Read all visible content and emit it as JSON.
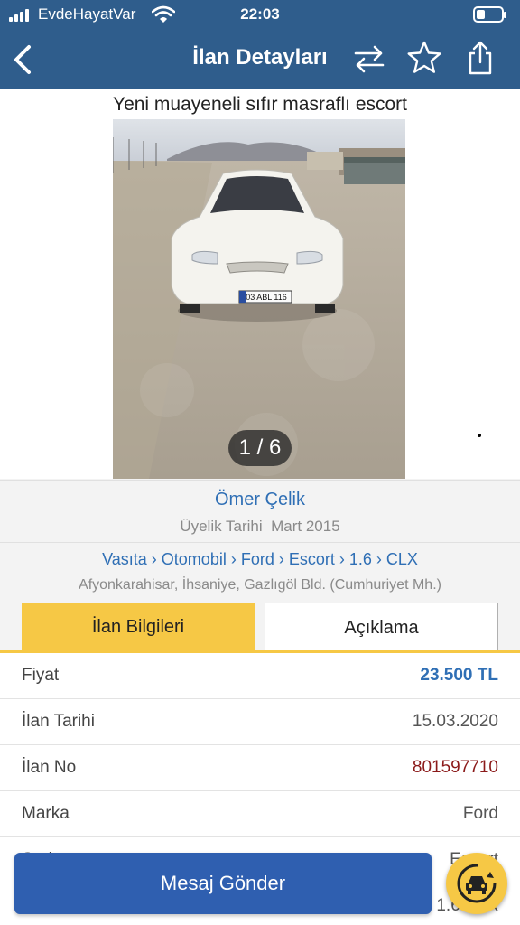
{
  "status": {
    "carrier": "EvdeHayatVar",
    "time": "22:03"
  },
  "header": {
    "title": "İlan Detayları",
    "back_icon": "chevron-left-icon",
    "swap_icon": "swap-arrows-icon",
    "favorite_icon": "star-icon",
    "share_icon": "share-icon"
  },
  "listing": {
    "title": "Yeni muayeneli sıfır masraflı escort",
    "photo_counter": "1 / 6",
    "plate": "03 ABL 116"
  },
  "seller": {
    "name": "Ömer Çelik",
    "member_since_label": "Üyelik Tarihi",
    "member_since_value": "Mart 2015"
  },
  "category": {
    "breadcrumb": "Vasıta › Otomobil › Ford › Escort › 1.6 › CLX",
    "location": "Afyonkarahisar, İhsaniye, Gazlıgöl Bld. (Cumhuriyet Mh.)"
  },
  "tabs": {
    "info": "İlan Bilgileri",
    "description": "Açıklama"
  },
  "details": [
    {
      "key": "Fiyat",
      "value": "23.500 TL"
    },
    {
      "key": "İlan Tarihi",
      "value": "15.03.2020"
    },
    {
      "key": "İlan No",
      "value": "801597710"
    },
    {
      "key": "Marka",
      "value": "Ford"
    },
    {
      "key": "Seri",
      "value": "Escort"
    },
    {
      "key": "Model",
      "value": "1.6 CLX"
    }
  ],
  "cta": {
    "label": "Mesaj Gönder",
    "fab_icon": "car-icon"
  },
  "colors": {
    "header": "#2f5d8c",
    "accent_yellow": "#f6c845",
    "link_blue": "#2f6fb5",
    "cta_blue": "#2f5fb0"
  }
}
